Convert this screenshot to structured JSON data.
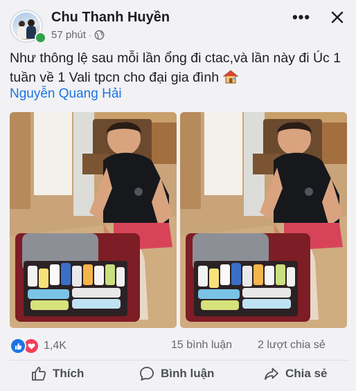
{
  "post": {
    "author": "Chu Thanh Huyền",
    "time": "57 phút",
    "separator": "·",
    "privacy_icon": "globe-icon",
    "caption": "Như thông lệ sau mỗi lần ổng đi ctac,và lần này đi Úc 1 tuần về 1 Vali tpcn cho đại gia đình",
    "caption_emoji": "house-icon",
    "tagged_person": "Nguyễn Quang Hải",
    "photos": 2
  },
  "stats": {
    "reaction_icons": [
      "like-icon",
      "love-icon"
    ],
    "reaction_count": "1,4K",
    "comments": "15 bình luận",
    "shares": "2 lượt chia sẻ"
  },
  "actions": {
    "like": "Thích",
    "comment": "Bình luận",
    "share": "Chia sẻ"
  },
  "colors": {
    "background": "#f2f2f4",
    "link": "#1b74e4",
    "online": "#31a24c",
    "like": "#1b74e4",
    "love": "#f33e58",
    "muted": "#65676b"
  }
}
